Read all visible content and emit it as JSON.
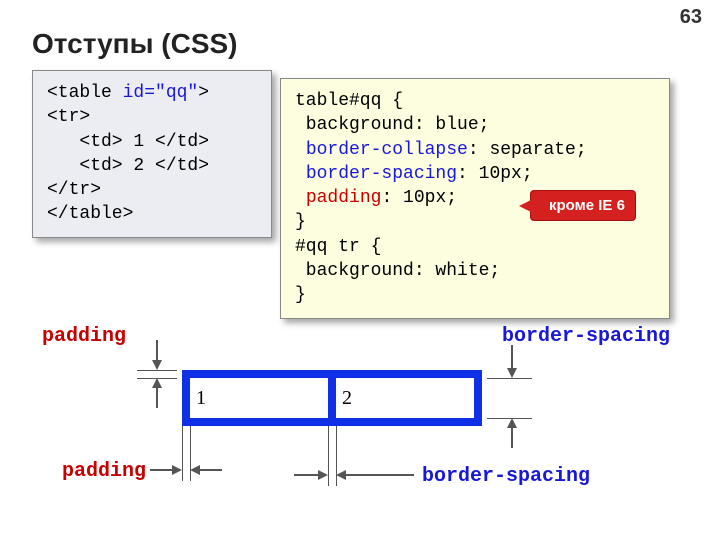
{
  "page_number": "63",
  "title": "Отступы (CSS)",
  "html_code": {
    "l1a": "<table ",
    "l1b": "id=\"qq\"",
    "l1c": ">",
    "l2": "<tr>",
    "l3": "   <td> 1 </td>",
    "l4": "   <td> 2 </td>",
    "l5": "</tr>",
    "l6": "</table>"
  },
  "css_code": {
    "l1": "table#qq {",
    "l2": " background: blue;",
    "l3a": " ",
    "l3b": "border-collapse",
    "l3c": ": separate;",
    "l4a": " ",
    "l4b": "border-spacing",
    "l4c": ": 10px;",
    "l5a": " ",
    "l5b": "padding",
    "l5c": ": 10px;",
    "l6": "}",
    "l7": "#qq tr {",
    "l8": " background: white;",
    "l9": "}"
  },
  "callout": "кроме IE 6",
  "diagram": {
    "padding_top": "padding",
    "padding_bottom": "padding",
    "spacing_top": "border-spacing",
    "spacing_bottom": "border-spacing",
    "cell1": "1",
    "cell2": "2"
  }
}
